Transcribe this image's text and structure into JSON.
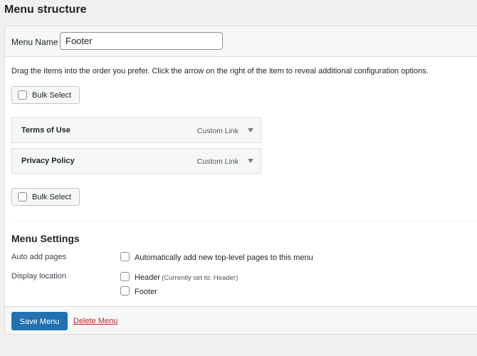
{
  "page": {
    "title": "Menu structure"
  },
  "menu_name": {
    "label": "Menu Name",
    "value": "Footer"
  },
  "instructions": "Drag the items into the order you prefer. Click the arrow on the right of the item to reveal additional configuration options.",
  "bulk_select": {
    "label": "Bulk Select"
  },
  "menu_items": [
    {
      "title": "Terms of Use",
      "type": "Custom Link"
    },
    {
      "title": "Privacy Policy",
      "type": "Custom Link"
    }
  ],
  "settings": {
    "title": "Menu Settings",
    "auto_add": {
      "label": "Auto add pages",
      "option": "Automatically add new top-level pages to this menu"
    },
    "display_location": {
      "label": "Display location",
      "options": [
        {
          "label": "Header",
          "note": "(Currently set to: Header)"
        },
        {
          "label": "Footer",
          "note": ""
        }
      ]
    }
  },
  "actions": {
    "save_label": "Save Menu",
    "delete_label": "Delete Menu"
  },
  "colors": {
    "primary": "#2271b1",
    "danger": "#b32d2e",
    "background": "#f0f0f1"
  }
}
